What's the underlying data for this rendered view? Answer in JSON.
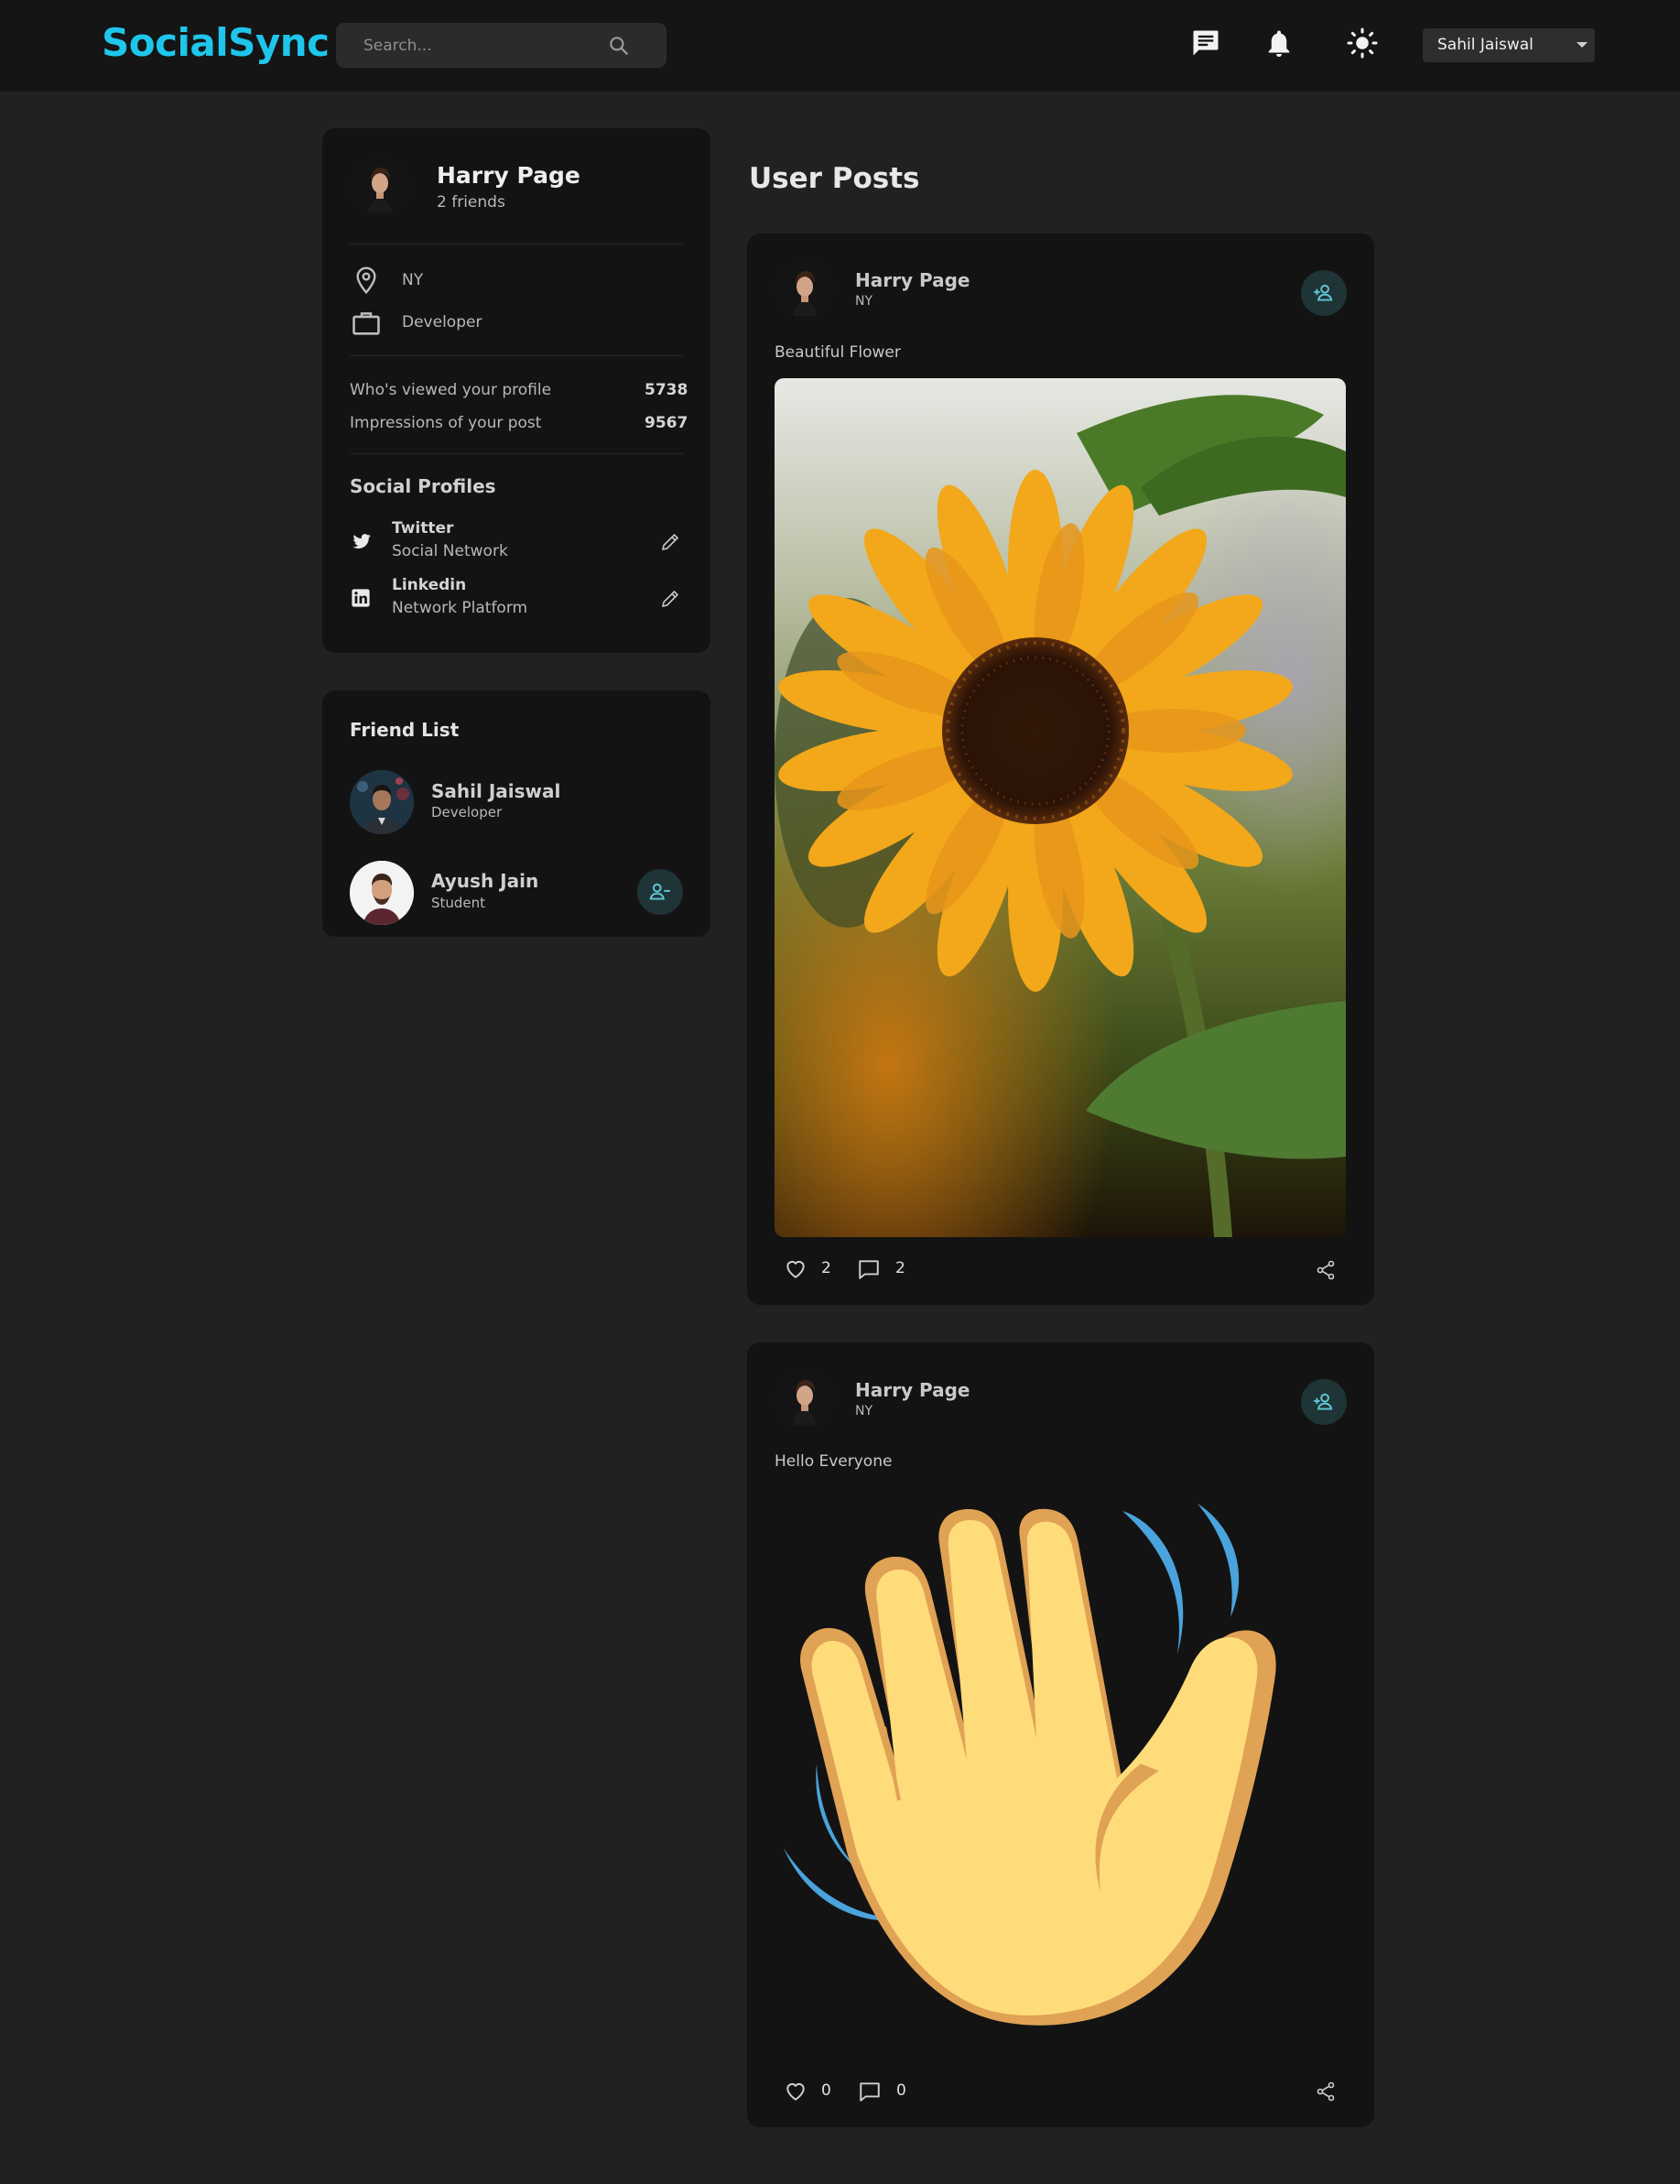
{
  "app": {
    "logo": "SocialSync"
  },
  "search": {
    "placeholder": "Search..."
  },
  "navbar": {
    "icons": [
      "message-icon",
      "bell-icon",
      "sun-icon"
    ],
    "user": "Sahil Jaiswal",
    "accent": "#1ec6ec"
  },
  "profile": {
    "name": "Harry Page",
    "friends": "2 friends",
    "location": "NY",
    "occupation": "Developer",
    "stats": [
      {
        "label": "Who's viewed your profile",
        "value": "5738"
      },
      {
        "label": "Impressions of your post",
        "value": "9567"
      }
    ],
    "social_title": "Social Profiles",
    "socials": [
      {
        "name": "Twitter",
        "desc": "Social Network",
        "icon": "twitter-icon"
      },
      {
        "name": "Linkedin",
        "desc": "Network Platform",
        "icon": "linkedin-icon"
      }
    ]
  },
  "friends": {
    "title": "Friend List",
    "items": [
      {
        "name": "Sahil Jaiswal",
        "role": "Developer"
      },
      {
        "name": "Ayush Jain",
        "role": "Student"
      }
    ]
  },
  "posts": {
    "title": "User Posts",
    "items": [
      {
        "author": "Harry Page",
        "location": "NY",
        "text": "Beautiful Flower",
        "likes": "2",
        "comments": "2",
        "image": "sunflower"
      },
      {
        "author": "Harry Page",
        "location": "NY",
        "text": "Hello Everyone",
        "likes": "0",
        "comments": "0",
        "image": "waving-hand-emoji"
      }
    ]
  }
}
